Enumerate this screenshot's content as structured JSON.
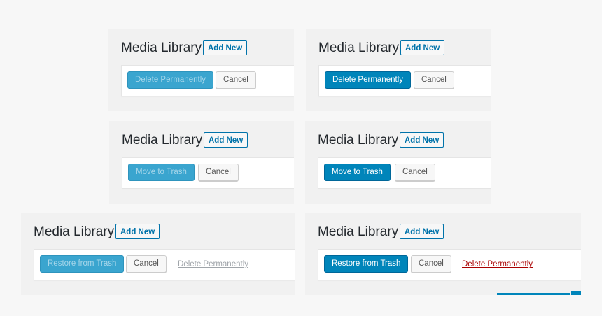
{
  "panels": [
    {
      "title": "Media Library",
      "add_new": "Add New",
      "primary": "Delete Permanently",
      "cancel": "Cancel"
    },
    {
      "title": "Media Library",
      "add_new": "Add New",
      "primary": "Delete Permanently",
      "cancel": "Cancel"
    },
    {
      "title": "Media Library",
      "add_new": "Add New",
      "primary": "Move to Trash",
      "cancel": "Cancel"
    },
    {
      "title": "Media Library",
      "add_new": "Add New",
      "primary": "Move to Trash",
      "cancel": "Cancel"
    },
    {
      "title": "Media Library",
      "add_new": "Add New",
      "primary": "Restore from Trash",
      "cancel": "Cancel",
      "delete_link": "Delete Permanently"
    },
    {
      "title": "Media Library",
      "add_new": "Add New",
      "primary": "Restore from Trash",
      "cancel": "Cancel",
      "delete_link": "Delete Permanently"
    }
  ],
  "colors": {
    "primary": "#0085ba",
    "primary_disabled": "#3aa5cf",
    "link": "#0073aa",
    "delete_active": "#aa0000",
    "delete_disabled": "#a0a5aa"
  }
}
